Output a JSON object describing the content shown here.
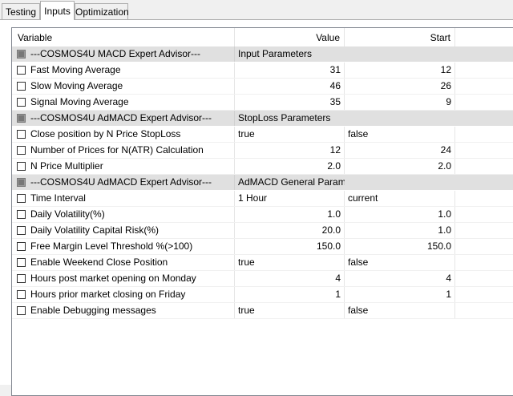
{
  "tabs": [
    {
      "label": "Testing",
      "active": false
    },
    {
      "label": "Inputs",
      "active": true
    },
    {
      "label": "Optimization",
      "active": false
    }
  ],
  "table": {
    "headers": {
      "variable": "Variable",
      "value": "Value",
      "start": "Start"
    },
    "rows": [
      {
        "type": "group",
        "variable": "---COSMOS4U MACD Expert Advisor---",
        "value": "Input Parameters",
        "start": ""
      },
      {
        "type": "param",
        "variable": "Fast Moving Average",
        "value": "31",
        "start": "12",
        "align": "num"
      },
      {
        "type": "param",
        "variable": "Slow Moving Average",
        "value": "46",
        "start": "26",
        "align": "num"
      },
      {
        "type": "param",
        "variable": "Signal Moving Average",
        "value": "35",
        "start": "9",
        "align": "num"
      },
      {
        "type": "group",
        "variable": "---COSMOS4U AdMACD Expert Advisor---",
        "value": "StopLoss Parameters",
        "start": ""
      },
      {
        "type": "param",
        "variable": "Close position by N Price StopLoss",
        "value": "true",
        "start": "false",
        "align": "txt"
      },
      {
        "type": "param",
        "variable": "Number of Prices for N(ATR) Calculation",
        "value": "12",
        "start": "24",
        "align": "num"
      },
      {
        "type": "param",
        "variable": "N Price Multiplier",
        "value": "2.0",
        "start": "2.0",
        "align": "num"
      },
      {
        "type": "group",
        "variable": "---COSMOS4U AdMACD Expert Advisor---",
        "value": "AdMACD General Parameters",
        "start": ""
      },
      {
        "type": "param",
        "variable": "Time Interval",
        "value": "1 Hour",
        "start": "current",
        "align": "txt"
      },
      {
        "type": "param",
        "variable": "Daily Volatility(%)",
        "value": "1.0",
        "start": "1.0",
        "align": "num"
      },
      {
        "type": "param",
        "variable": "Daily Volatility Capital Risk(%)",
        "value": "20.0",
        "start": "1.0",
        "align": "num"
      },
      {
        "type": "param",
        "variable": "Free Margin Level Threshold %(>100)",
        "value": "150.0",
        "start": "150.0",
        "align": "num"
      },
      {
        "type": "param",
        "variable": "Enable Weekend Close Position",
        "value": "true",
        "start": "false",
        "align": "txt"
      },
      {
        "type": "param",
        "variable": "Hours post market opening on Monday",
        "value": "4",
        "start": "4",
        "align": "num"
      },
      {
        "type": "param",
        "variable": "Hours prior market closing on Friday",
        "value": "1",
        "start": "1",
        "align": "num"
      },
      {
        "type": "param",
        "variable": "Enable Debugging messages",
        "value": "true",
        "start": "false",
        "align": "txt"
      }
    ]
  }
}
